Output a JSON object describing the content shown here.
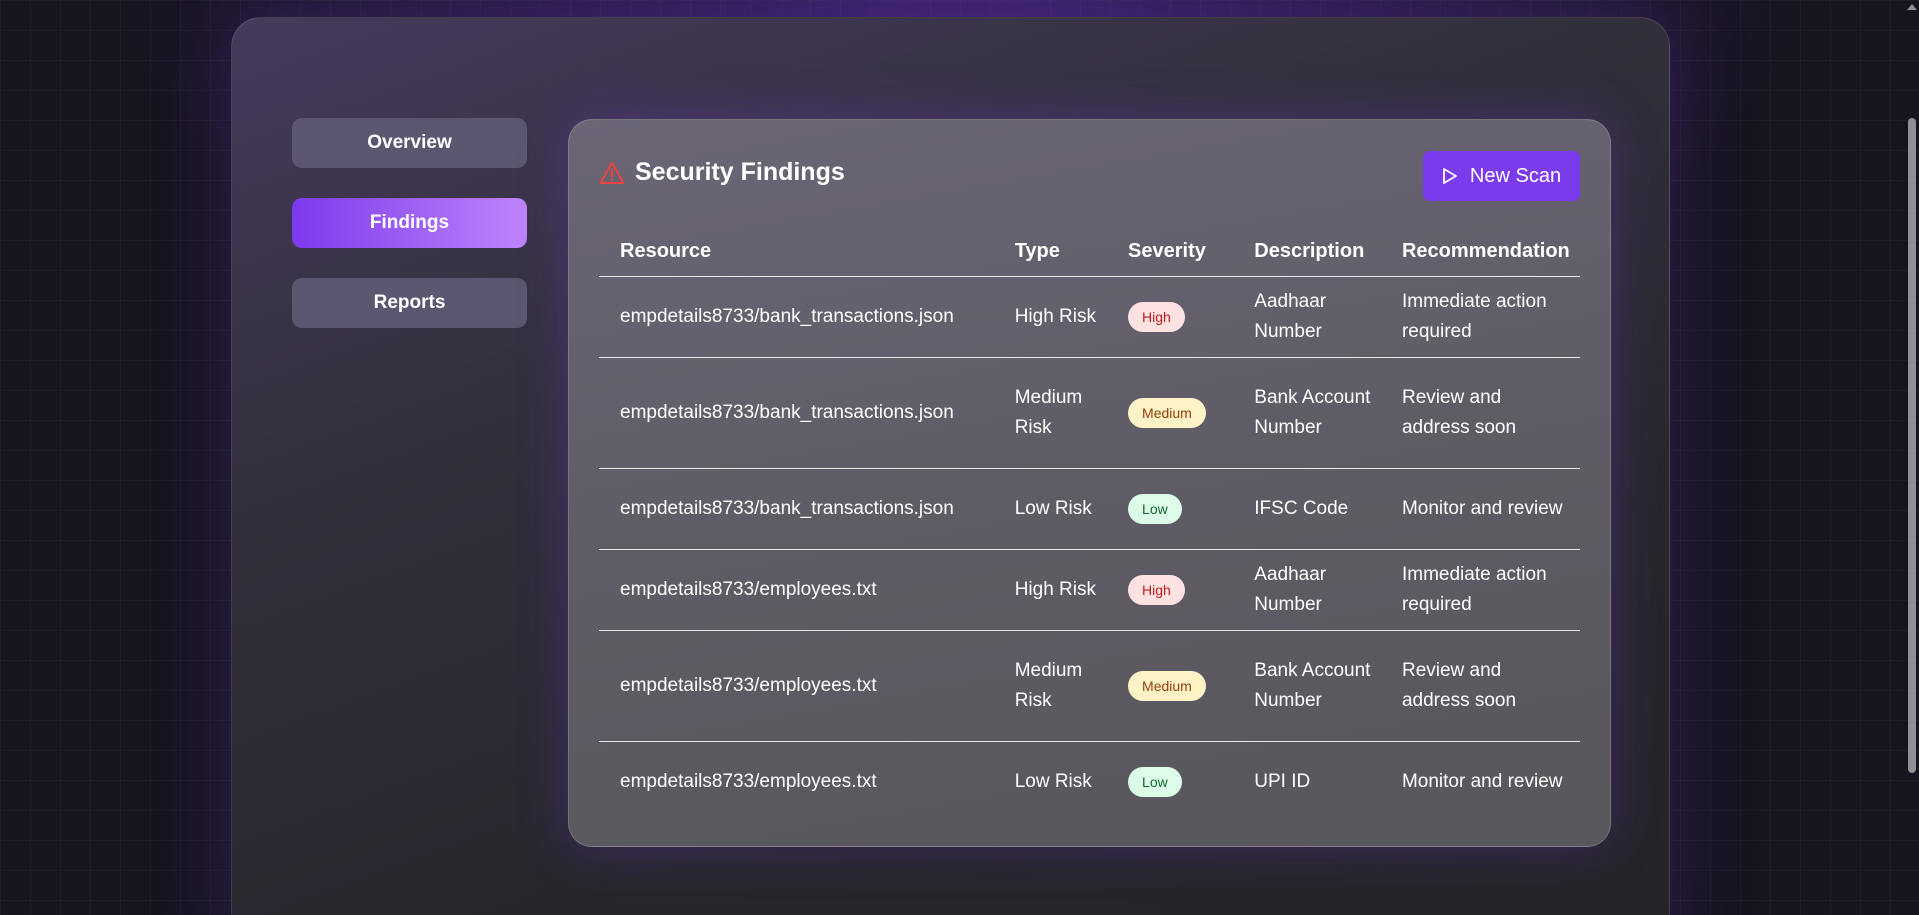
{
  "sidebar": {
    "items": [
      {
        "label": "Overview",
        "active": false
      },
      {
        "label": "Findings",
        "active": true
      },
      {
        "label": "Reports",
        "active": false
      }
    ]
  },
  "panel": {
    "title": "Security Findings",
    "title_icon": "warning-triangle-icon",
    "new_scan": {
      "label": "New Scan",
      "icon": "play-icon"
    }
  },
  "table": {
    "headers": {
      "resource": "Resource",
      "type": "Type",
      "severity": "Severity",
      "description": "Description",
      "recommendation": "Recommendation"
    },
    "rows": [
      {
        "resource": "empdetails8733/bank_transactions.json",
        "type": "High Risk",
        "severity": "High",
        "description": "Aadhaar Number",
        "recommendation": "Immediate action required"
      },
      {
        "resource": "empdetails8733/bank_transactions.json",
        "type": "Medium Risk",
        "severity": "Medium",
        "description": "Bank Account Number",
        "recommendation": "Review and address soon"
      },
      {
        "resource": "empdetails8733/bank_transactions.json",
        "type": "Low Risk",
        "severity": "Low",
        "description": "IFSC Code",
        "recommendation": "Monitor and review"
      },
      {
        "resource": "empdetails8733/employees.txt",
        "type": "High Risk",
        "severity": "High",
        "description": "Aadhaar Number",
        "recommendation": "Immediate action required"
      },
      {
        "resource": "empdetails8733/employees.txt",
        "type": "Medium Risk",
        "severity": "Medium",
        "description": "Bank Account Number",
        "recommendation": "Review and address soon"
      },
      {
        "resource": "empdetails8733/employees.txt",
        "type": "Low Risk",
        "severity": "Low",
        "description": "UPI ID",
        "recommendation": "Monitor and review"
      }
    ]
  },
  "colors": {
    "accent": "#7c3aed",
    "high_bg": "#fee2e2",
    "high_text": "#b91c1c",
    "medium_bg": "#fef3c7",
    "medium_text": "#92400e",
    "low_bg": "#dcfce7",
    "low_text": "#166534",
    "warning_icon": "#ef4444"
  }
}
